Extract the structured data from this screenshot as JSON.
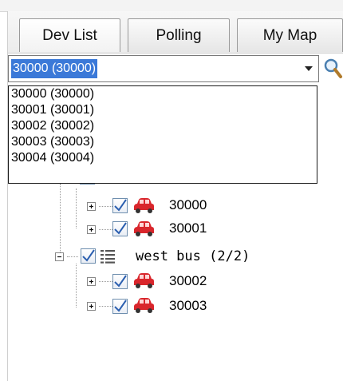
{
  "tabs": [
    {
      "label": "Dev List"
    },
    {
      "label": "Polling"
    },
    {
      "label": "My Map"
    }
  ],
  "device_select": {
    "value": "30000 (30000)",
    "options": [
      "30000 (30000)",
      "30001 (30001)",
      "30002 (30002)",
      "30003 (30003)",
      "30004 (30004)"
    ]
  },
  "tree": {
    "group_1_devices": [
      "30000",
      "30001"
    ],
    "group_2": {
      "name": "west bus",
      "count": "(2/2)"
    },
    "group_2_devices": [
      "30002",
      "30003"
    ]
  },
  "colors": {
    "selection": "#3b79d8",
    "car": "#d9262c",
    "check": "#2b5fb0"
  }
}
